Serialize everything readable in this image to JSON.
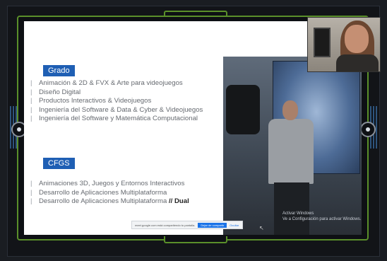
{
  "slide": {
    "grado_badge": "Grado",
    "grado_items": [
      "Animación & 2D & FVX & Arte para videojuegos",
      "Diseño Digital",
      "Productos Interactivos & Videojuegos",
      "Ingeniería del Software & Data & Cyber & Videojuegos",
      "Ingeniería del Software y Matemática Computacional"
    ],
    "cfgs_badge": "CFGS",
    "cfgs_items": [
      "Animaciones 3D, Juegos y Entornos Interactivos",
      "Desarrollo de Aplicaciones Multiplataforma",
      "Desarrollo de Aplicaciones Multiplataforma"
    ],
    "cfgs_last_suffix": "// Dual",
    "bullet_glyph": "|",
    "photo_watermark_line1": "Activar Windows",
    "photo_watermark_line2": "Ve a Configuración para activar Windows."
  },
  "notification": {
    "message": "meet.google.com está compartiendo tu pantalla.",
    "share_label": "Dejar de compartir",
    "hide_label": "Ocultar"
  },
  "colors": {
    "badge_blue": "#1f5fb4",
    "frame_green": "#5a8f2a"
  }
}
